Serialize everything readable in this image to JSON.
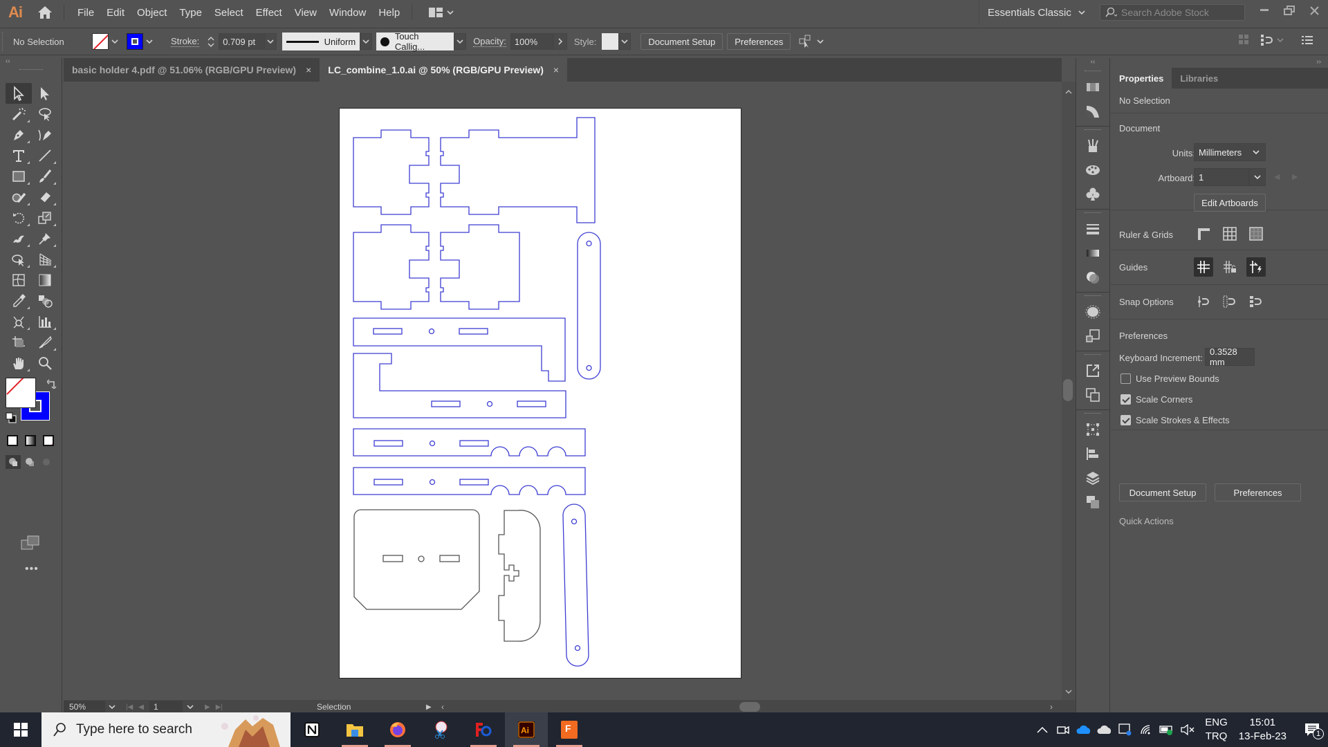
{
  "app": {
    "logo": "Ai",
    "menu": [
      "File",
      "Edit",
      "Object",
      "Type",
      "Select",
      "Effect",
      "View",
      "Window",
      "Help"
    ],
    "workspace": "Essentials Classic",
    "stock_search_placeholder": "Search Adobe Stock",
    "window_controls": [
      "minimize",
      "restore",
      "close"
    ]
  },
  "control_bar": {
    "selection_label": "No Selection",
    "stroke_label": "Stroke:",
    "stroke_weight": "0.709 pt",
    "stroke_profile": "Uniform",
    "brush": "Touch Callig...",
    "opacity_label": "Opacity:",
    "opacity_value": "100%",
    "style_label": "Style:",
    "document_setup": "Document Setup",
    "preferences": "Preferences",
    "colors": {
      "stroke": "#0000ff",
      "fill": "none"
    }
  },
  "tabs": [
    {
      "label": "basic holder 4.pdf @ 51.06% (RGB/GPU Preview)",
      "active": false,
      "close": "×"
    },
    {
      "label": "LC_combine_1.0.ai @ 50% (RGB/GPU Preview)",
      "active": true,
      "close": "×"
    }
  ],
  "tools": [
    [
      "selection-tool",
      "direct-selection-tool"
    ],
    [
      "magic-wand-tool",
      "lasso-tool"
    ],
    [
      "pen-tool",
      "curvature-tool"
    ],
    [
      "type-tool",
      "line-segment-tool"
    ],
    [
      "rectangle-tool",
      "paintbrush-tool"
    ],
    [
      "shaper-tool",
      "eraser-tool"
    ],
    [
      "rotate-tool",
      "scale-tool"
    ],
    [
      "puppet-warp-tool",
      "pin-tool"
    ],
    [
      "free-transform-tool",
      "perspective-grid-tool"
    ],
    [
      "mesh-tool",
      "gradient-tool"
    ],
    [
      "eyedropper-tool",
      "blend-tool"
    ],
    [
      "symbol-sprayer-tool",
      "column-graph-tool"
    ],
    [
      "artboard-tool",
      "slice-tool"
    ],
    [
      "hand-tool",
      "zoom-tool"
    ]
  ],
  "status_bar": {
    "zoom": "50%",
    "artboard_number": "1",
    "current_tool": "Selection"
  },
  "properties_panel": {
    "tabs": [
      "Properties",
      "Libraries"
    ],
    "active_tab": "Properties",
    "selection": "No Selection",
    "document": {
      "title": "Document",
      "units_label": "Units:",
      "units_value": "Millimeters",
      "artboard_label": "Artboard:",
      "artboard_value": "1",
      "edit_artboards": "Edit Artboards"
    },
    "ruler_grids": "Ruler & Grids",
    "guides": "Guides",
    "snap_options": "Snap Options",
    "preferences": {
      "title": "Preferences",
      "keyboard_increment_label": "Keyboard Increment:",
      "keyboard_increment_value": "0.3528 mm",
      "use_preview_bounds": {
        "label": "Use Preview Bounds",
        "checked": false
      },
      "scale_corners": {
        "label": "Scale Corners",
        "checked": true
      },
      "scale_strokes_effects": {
        "label": "Scale Strokes & Effects",
        "checked": true
      }
    },
    "quick_actions": {
      "title": "Quick Actions",
      "document_setup": "Document Setup",
      "preferences": "Preferences"
    }
  },
  "taskbar": {
    "search_placeholder": "Type here to search",
    "apps": [
      "Notion",
      "File Explorer",
      "Firefox",
      "Snipping Tool",
      "Autodesk Fusion",
      "Adobe Illustrator",
      "Fusion 360"
    ],
    "language": [
      "ENG",
      "TRQ"
    ],
    "time": "15:01",
    "date": "13-Feb-23",
    "notification_count": "1"
  },
  "artwork": {
    "stroke_blue": "#3c3cd2",
    "stroke_gray": "#555555"
  }
}
